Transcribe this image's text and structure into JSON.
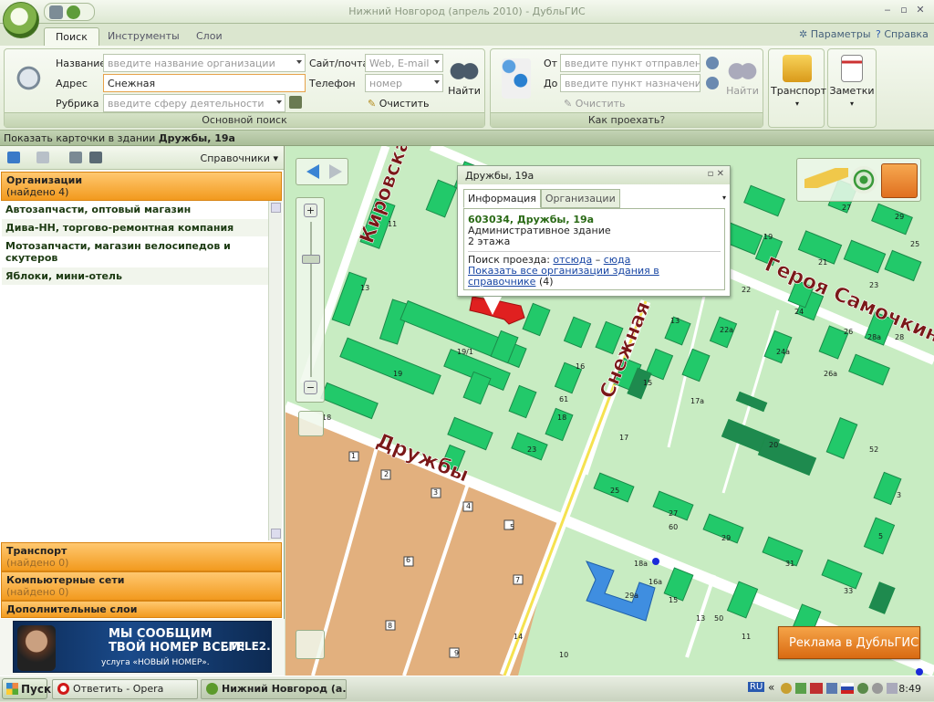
{
  "window": {
    "title": "Нижний Новгород (апрель 2010) - ДубльГИС"
  },
  "ribbon": {
    "tabs": [
      "Поиск",
      "Инструменты",
      "Слои"
    ],
    "right_links": [
      "Параметры",
      "Справка"
    ],
    "main_search": {
      "caption": "Основной поиск",
      "name_label": "Название",
      "name_placeholder": "введите название организации",
      "address_label": "Адрес",
      "address_value": "Снежная",
      "rubric_label": "Рубрика",
      "rubric_placeholder": "введите сферу деятельности",
      "site_label": "Сайт/почта",
      "site_placeholder": "Web, E-mail",
      "phone_label": "Телефон",
      "phone_placeholder": "номер",
      "clear_label": "Очистить",
      "find_label": "Найти"
    },
    "route": {
      "caption": "Как проехать?",
      "from_label": "От",
      "from_placeholder": "введите пункт отправления",
      "to_label": "До",
      "to_placeholder": "введите пункт назначения",
      "clear_label": "Очистить",
      "find_label": "Найти"
    },
    "transport_label": "Транспорт",
    "notes_label": "Заметки"
  },
  "status": {
    "prefix": "Показать карточки в здании",
    "building": "Дружбы, 19а"
  },
  "left_panel": {
    "directory_label": "Справочники",
    "sections": [
      {
        "title": "Организации",
        "sub": "(найдено 4)"
      },
      {
        "title": "Транспорт",
        "sub": "(найдено 0)"
      },
      {
        "title": "Компьютерные сети",
        "sub": "(найдено 0)"
      },
      {
        "title": "Дополнительные слои",
        "sub": ""
      }
    ],
    "organizations": [
      "Автозапчасти, оптовый магазин",
      "Дива-НН, торгово-ремонтная компания",
      "Мотозапчасти, магазин велосипедов и скутеров",
      "Яблоки, мини-отель"
    ],
    "banner": {
      "line1": "МЫ СООБЩИМ",
      "line2": "ТВОЙ НОМЕР ВСЕМ!",
      "line3": "услуга «НОВЫЙ НОМЕР».",
      "brand": ".TELE2."
    }
  },
  "popup": {
    "title": "Дружбы, 19а",
    "tabs": [
      "Информация",
      "Организации"
    ],
    "address": "603034, Дружбы, 19а",
    "type": "Административное здание",
    "floors": "2 этажа",
    "route_label": "Поиск проезда:",
    "route_from": "отсюда",
    "route_dash": "–",
    "route_to": "сюда",
    "show_all": "Показать все организации здания в справочнике",
    "show_all_count": "(4)"
  },
  "map": {
    "streets": [
      "Кировская",
      "Снежная",
      "Дружбы",
      "Героя Самочкина"
    ],
    "house_numbers": [
      "11",
      "13",
      "7",
      "13",
      "19/1",
      "19",
      "16",
      "18",
      "15",
      "17",
      "23",
      "25",
      "27",
      "29",
      "31",
      "33",
      "17а",
      "24",
      "22",
      "22а",
      "24а",
      "26а",
      "26",
      "28а",
      "28",
      "19",
      "21",
      "23",
      "25",
      "27",
      "29",
      "3",
      "5",
      "7",
      "9",
      "11",
      "13",
      "15",
      "16а",
      "18а",
      "1",
      "2",
      "3",
      "4",
      "5",
      "6",
      "7",
      "8",
      "9",
      "10",
      "14",
      "20",
      "29а",
      "50",
      "52",
      "60",
      "61",
      "18"
    ],
    "ad_button": "Реклама в ДубльГИС",
    "colors": {
      "land": "#c8ecc2",
      "road": "#ffffff",
      "house": "#22c96a",
      "house_dark": "#1e8a4e",
      "selected": "#e02020",
      "private": "#e2b07e",
      "school": "#3f8ee0"
    }
  },
  "taskbar": {
    "start_label": "Пуск",
    "items": [
      "Ответить - Opera",
      "Нижний Новгород (а..."
    ],
    "lang": "RU",
    "clock": "8:49"
  }
}
